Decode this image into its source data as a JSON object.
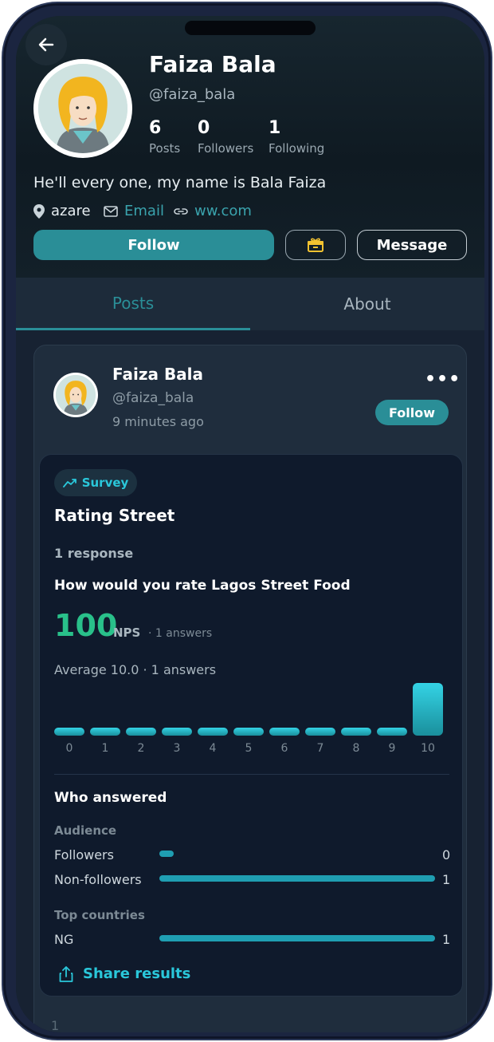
{
  "profile": {
    "name": "Faiza Bala",
    "handle": "@faiza_bala",
    "bio": "He'll every one, my name is Bala Faiza",
    "location": "azare",
    "email_label": "Email",
    "website": "ww.com",
    "stats": [
      {
        "value": "6",
        "label": "Posts"
      },
      {
        "value": "0",
        "label": "Followers"
      },
      {
        "value": "1",
        "label": "Following"
      }
    ]
  },
  "actions": {
    "follow_label": "Follow",
    "message_label": "Message"
  },
  "tabs": [
    {
      "label": "Posts",
      "active": true
    },
    {
      "label": "About",
      "active": false
    }
  ],
  "post": {
    "author": "Faiza Bala",
    "handle": "@faiza_bala",
    "time": "9 minutes ago",
    "follow_label": "Follow",
    "more_label": "•••"
  },
  "survey": {
    "badge": "Survey",
    "title": "Rating Street",
    "responses": "1 response",
    "question": "How would you rate Lagos Street Food",
    "nps_value": "100",
    "nps_label": "NPS",
    "nps_answers": "· 1 answers",
    "average": "Average 10.0 · 1 answers",
    "who_answered": "Who answered",
    "audience_label": "Audience",
    "countries_label": "Top countries",
    "share_label": "Share results"
  },
  "chart_data": {
    "type": "bar",
    "categories": [
      "0",
      "1",
      "2",
      "3",
      "4",
      "5",
      "6",
      "7",
      "8",
      "9",
      "10"
    ],
    "values": [
      0,
      0,
      0,
      0,
      0,
      0,
      0,
      0,
      0,
      0,
      1
    ],
    "xlabel": "",
    "ylabel": ""
  },
  "audience": [
    {
      "label": "Followers",
      "value": 0,
      "fraction": 0
    },
    {
      "label": "Non-followers",
      "value": 1,
      "fraction": 1
    }
  ],
  "countries": [
    {
      "label": "NG",
      "value": 1,
      "fraction": 1
    }
  ],
  "footer_peek": "1",
  "colors": {
    "accent": "#2a8e97",
    "nps_green": "#29c08a",
    "cyan": "#2ac7da"
  }
}
